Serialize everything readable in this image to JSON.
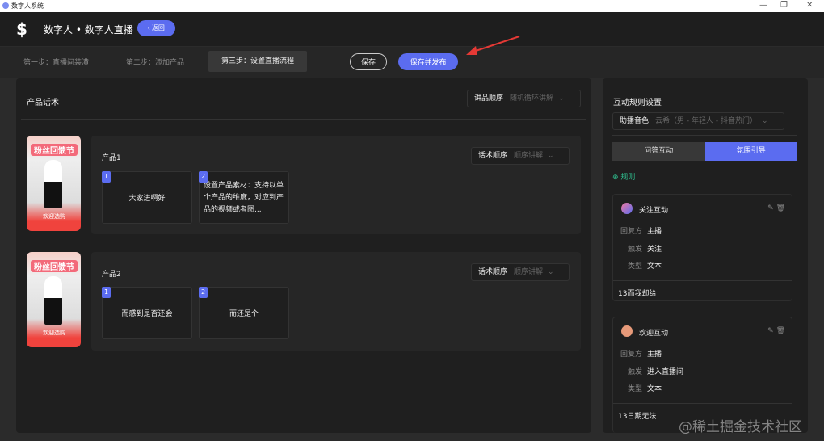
{
  "window": {
    "title": "数字人系统",
    "controls": [
      "—",
      "❐",
      "✕"
    ]
  },
  "header": {
    "title": "数字人 • 数字人直播",
    "back_label": "‹ 返回"
  },
  "steps": {
    "items": [
      "第一步：直播间装潢",
      "第二步：添加产品",
      "第三步：设置直播流程"
    ],
    "active": 2,
    "save_label": "保存",
    "publish_label": "保存并发布"
  },
  "main": {
    "title": "产品话术",
    "order_select": {
      "label": "讲品顺序",
      "value": "随机循环讲解"
    },
    "products": [
      {
        "name": "产品1",
        "select": {
          "label": "话术顺序",
          "value": "顺序讲解"
        },
        "thumb_banner": "粉丝回馈节",
        "thumb_footer": "欢迎选购",
        "scripts": [
          {
            "no": "1",
            "text": "大家进啊好"
          },
          {
            "no": "2",
            "text": "设置产品素材：支持以单个产品的维度，对应到产品的视频或者图..."
          }
        ]
      },
      {
        "name": "产品2",
        "select": {
          "label": "话术顺序",
          "value": "顺序讲解"
        },
        "thumb_banner": "粉丝回馈节",
        "thumb_footer": "欢迎选购",
        "scripts": [
          {
            "no": "1",
            "text": "而感到是否还会"
          },
          {
            "no": "2",
            "text": "而还是个"
          }
        ]
      }
    ]
  },
  "side": {
    "title": "互动规则设置",
    "voice": {
      "label": "助播音色",
      "value": "云希（男 - 年轻人 - 抖音热门）"
    },
    "tabs": [
      "问答互动",
      "氛围引导"
    ],
    "active_tab": 1,
    "add_rule": "规则",
    "rules": [
      {
        "name": "关注互动",
        "icon": "rocket-icon",
        "fields": [
          {
            "k": "回复方",
            "v": "主播"
          },
          {
            "k": "触发",
            "v": "关注"
          },
          {
            "k": "类型",
            "v": "文本"
          }
        ],
        "content": "13而我却给"
      },
      {
        "name": "欢迎互动",
        "icon": "clap-icon",
        "fields": [
          {
            "k": "回复方",
            "v": "主播"
          },
          {
            "k": "触发",
            "v": "进入直播间"
          },
          {
            "k": "类型",
            "v": "文本"
          }
        ],
        "content": "13日期无法"
      }
    ]
  },
  "watermark": "@稀土掘金技术社区",
  "colors": {
    "accent": "#5b6cf0",
    "green": "#2fbf8f",
    "arrow": "#e53935"
  }
}
